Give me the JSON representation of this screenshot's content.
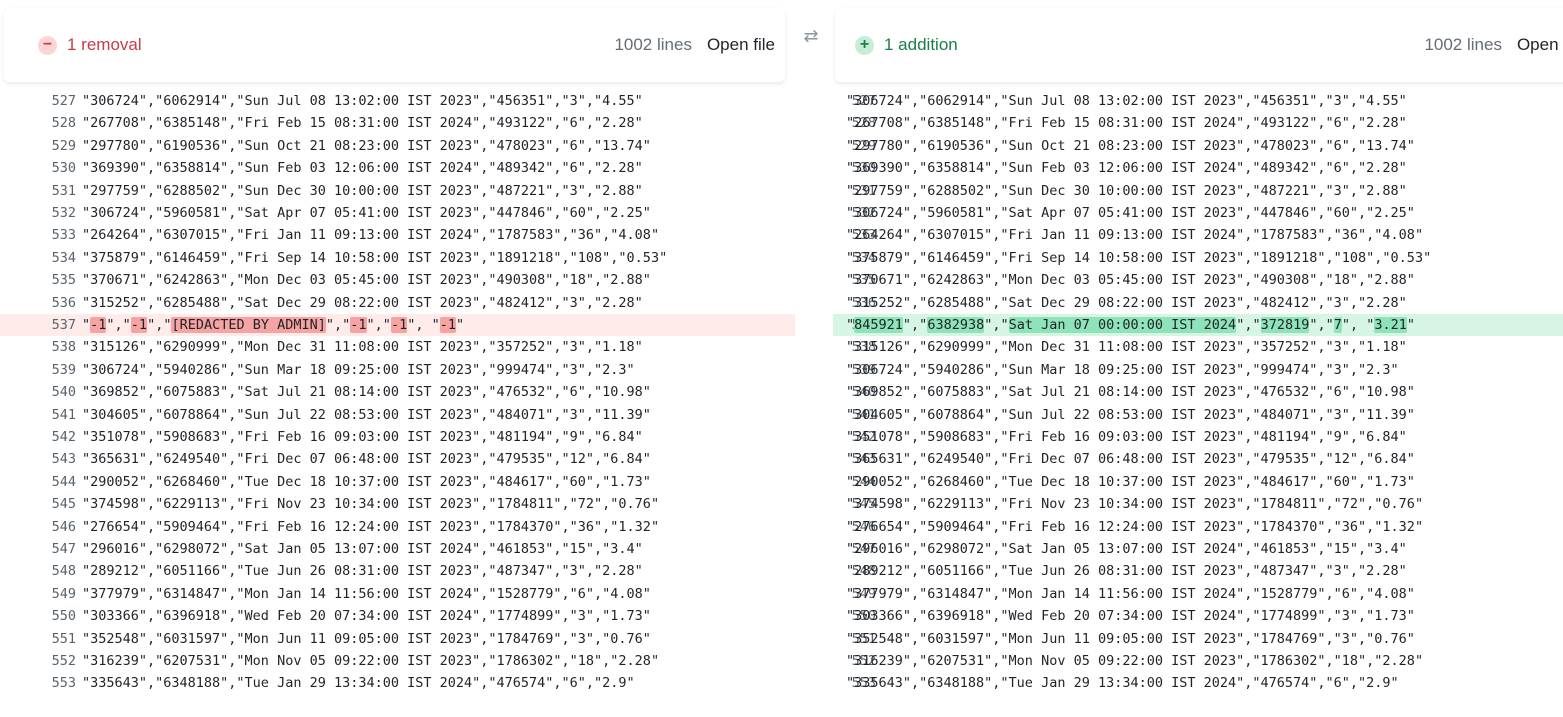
{
  "left": {
    "status_icon": "−",
    "status_label": "1 removal",
    "lines_count": "1002 lines",
    "open_file": "Open file"
  },
  "right": {
    "status_icon": "+",
    "status_label": "1 addition",
    "lines_count": "1002 lines",
    "open_file": "Open file"
  },
  "swap_icon": "⇄",
  "rows": [
    {
      "n": "527",
      "text": "\"306724\",\"6062914\",\"Sun Jul 08 13:02:00 IST 2023\",\"456351\",\"3\",\"4.55\""
    },
    {
      "n": "528",
      "text": "\"267708\",\"6385148\",\"Fri Feb 15 08:31:00 IST 2024\",\"493122\",\"6\",\"2.28\""
    },
    {
      "n": "529",
      "text": "\"297780\",\"6190536\",\"Sun Oct 21 08:23:00 IST 2023\",\"478023\",\"6\",\"13.74\""
    },
    {
      "n": "530",
      "text": "\"369390\",\"6358814\",\"Sun Feb 03 12:06:00 IST 2024\",\"489342\",\"6\",\"2.28\""
    },
    {
      "n": "531",
      "text": "\"297759\",\"6288502\",\"Sun Dec 30 10:00:00 IST 2023\",\"487221\",\"3\",\"2.88\""
    },
    {
      "n": "532",
      "text": "\"306724\",\"5960581\",\"Sat Apr 07 05:41:00 IST 2023\",\"447846\",\"60\",\"2.25\""
    },
    {
      "n": "533",
      "text": "\"264264\",\"6307015\",\"Fri Jan 11 09:13:00 IST 2024\",\"1787583\",\"36\",\"4.08\""
    },
    {
      "n": "534",
      "text": "\"375879\",\"6146459\",\"Fri Sep 14 10:58:00 IST 2023\",\"1891218\",\"108\",\"0.53\""
    },
    {
      "n": "535",
      "text": "\"370671\",\"6242863\",\"Mon Dec 03 05:45:00 IST 2023\",\"490308\",\"18\",\"2.88\""
    },
    {
      "n": "536",
      "text": "\"315252\",\"6285488\",\"Sat Dec 29 08:22:00 IST 2023\",\"482412\",\"3\",\"2.28\""
    },
    {
      "n": "537",
      "changed": true
    },
    {
      "n": "538",
      "text": "\"315126\",\"6290999\",\"Mon Dec 31 11:08:00 IST 2023\",\"357252\",\"3\",\"1.18\""
    },
    {
      "n": "539",
      "text": "\"306724\",\"5940286\",\"Sun Mar 18 09:25:00 IST 2023\",\"999474\",\"3\",\"2.3\""
    },
    {
      "n": "540",
      "text": "\"369852\",\"6075883\",\"Sat Jul 21 08:14:00 IST 2023\",\"476532\",\"6\",\"10.98\""
    },
    {
      "n": "541",
      "text": "\"304605\",\"6078864\",\"Sun Jul 22 08:53:00 IST 2023\",\"484071\",\"3\",\"11.39\""
    },
    {
      "n": "542",
      "text": "\"351078\",\"5908683\",\"Fri Feb 16 09:03:00 IST 2023\",\"481194\",\"9\",\"6.84\""
    },
    {
      "n": "543",
      "text": "\"365631\",\"6249540\",\"Fri Dec 07 06:48:00 IST 2023\",\"479535\",\"12\",\"6.84\""
    },
    {
      "n": "544",
      "text": "\"290052\",\"6268460\",\"Tue Dec 18 10:37:00 IST 2023\",\"484617\",\"60\",\"1.73\""
    },
    {
      "n": "545",
      "text": "\"374598\",\"6229113\",\"Fri Nov 23 10:34:00 IST 2023\",\"1784811\",\"72\",\"0.76\""
    },
    {
      "n": "546",
      "text": "\"276654\",\"5909464\",\"Fri Feb 16 12:24:00 IST 2023\",\"1784370\",\"36\",\"1.32\""
    },
    {
      "n": "547",
      "text": "\"296016\",\"6298072\",\"Sat Jan 05 13:07:00 IST 2024\",\"461853\",\"15\",\"3.4\""
    },
    {
      "n": "548",
      "text": "\"289212\",\"6051166\",\"Tue Jun 26 08:31:00 IST 2023\",\"487347\",\"3\",\"2.28\""
    },
    {
      "n": "549",
      "text": "\"377979\",\"6314847\",\"Mon Jan 14 11:56:00 IST 2024\",\"1528779\",\"6\",\"4.08\""
    },
    {
      "n": "550",
      "text": "\"303366\",\"6396918\",\"Wed Feb 20 07:34:00 IST 2024\",\"1774899\",\"3\",\"1.73\""
    },
    {
      "n": "551",
      "text": "\"352548\",\"6031597\",\"Mon Jun 11 09:05:00 IST 2023\",\"1784769\",\"3\",\"0.76\""
    },
    {
      "n": "552",
      "text": "\"316239\",\"6207531\",\"Mon Nov 05 09:22:00 IST 2023\",\"1786302\",\"18\",\"2.28\""
    },
    {
      "n": "553",
      "text": "\"335643\",\"6348188\",\"Tue Jan 29 13:34:00 IST 2024\",\"476574\",\"6\",\"2.9\""
    }
  ],
  "removed_line": {
    "n": "537",
    "parts": [
      {
        "t": "\"",
        "h": false
      },
      {
        "t": "-1",
        "h": true
      },
      {
        "t": "\",\"",
        "h": false
      },
      {
        "t": "-1",
        "h": true
      },
      {
        "t": "\",\"",
        "h": false
      },
      {
        "t": "[REDACTED BY ADMIN]",
        "h": true
      },
      {
        "t": "\",\"",
        "h": false
      },
      {
        "t": "-1",
        "h": true
      },
      {
        "t": "\",\"",
        "h": false
      },
      {
        "t": "-1",
        "h": true
      },
      {
        "t": "\", \"",
        "h": false
      },
      {
        "t": "-1",
        "h": true
      },
      {
        "t": "\"",
        "h": false
      }
    ]
  },
  "added_line": {
    "n": "537",
    "parts": [
      {
        "t": "\"",
        "h": false
      },
      {
        "t": "845921",
        "h": true
      },
      {
        "t": "\",\"",
        "h": false
      },
      {
        "t": "6382938",
        "h": true
      },
      {
        "t": "\",\"",
        "h": false
      },
      {
        "t": "Sat Jan 07 00:00:00 IST 2024",
        "h": true
      },
      {
        "t": "\",\"",
        "h": false
      },
      {
        "t": "372819",
        "h": true
      },
      {
        "t": "\",\"",
        "h": false
      },
      {
        "t": "7",
        "h": true
      },
      {
        "t": "\", \"",
        "h": false
      },
      {
        "t": "3.21",
        "h": true
      },
      {
        "t": "\"",
        "h": false
      }
    ]
  }
}
